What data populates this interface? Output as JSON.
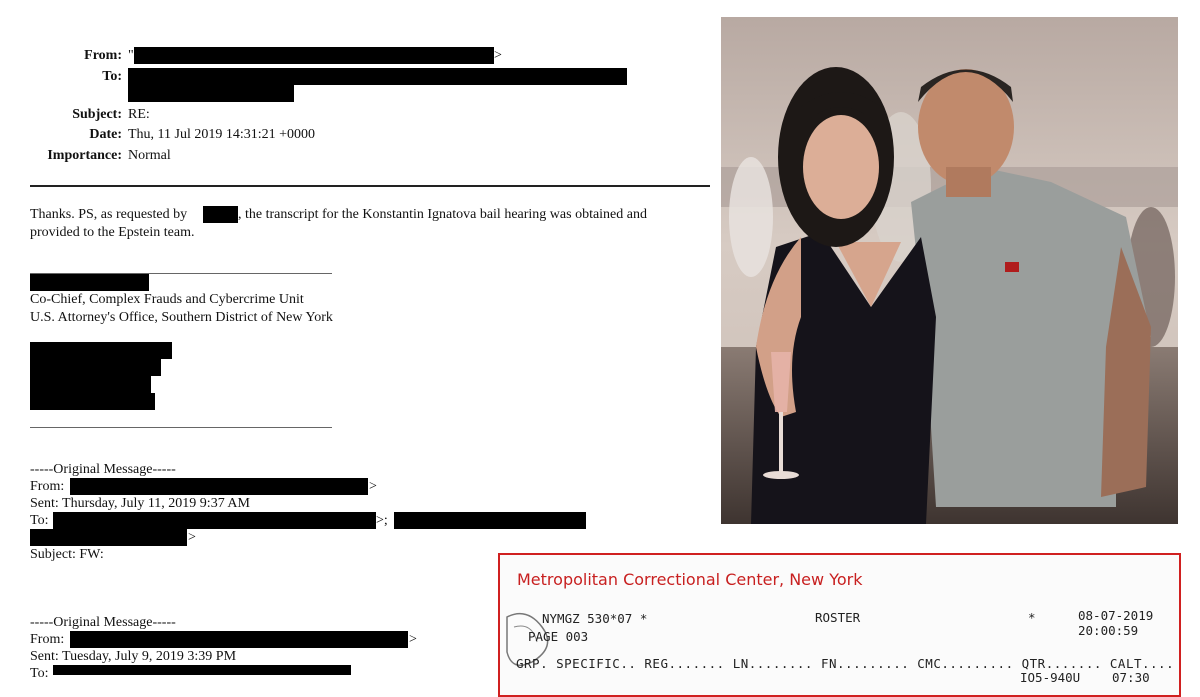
{
  "email": {
    "header": {
      "from_label": "From:",
      "from_prefix": "\"",
      "from_suffix": ">",
      "to_label": "To:",
      "subject_label": "Subject:",
      "subject_value": "RE:",
      "date_label": "Date:",
      "date_value": "Thu, 11 Jul 2019 14:31:21 +0000",
      "importance_label": "Importance:",
      "importance_value": "Normal"
    },
    "body_line1_a": "Thanks. PS, as requested by",
    "body_line1_b": ", the transcript for the Konstantin Ignatova bail hearing was obtained and",
    "body_line2": "provided to the Epstein team.",
    "signature_title": "Co-Chief, Complex Frauds and Cybercrime Unit",
    "signature_office": "U.S. Attorney's Office, Southern District of New York",
    "original_1": {
      "heading": "-----Original Message-----",
      "from_label": "From:",
      "from_suffix": ">",
      "sent_line": "Sent: Thursday, July 11, 2019 9:37 AM",
      "to_label": "To:",
      "to_sep": ">;",
      "to_suffix": ">",
      "subject_line": "Subject: FW:"
    },
    "original_2": {
      "heading": "-----Original Message-----",
      "from_label": "From:",
      "from_suffix": ">",
      "sent_line": "Sent: Tuesday, July 9, 2019 3:39 PM",
      "to_label": "To:"
    }
  },
  "roster": {
    "title": "Metropolitan Correctional Center, New York",
    "line1_a": "NYMGZ  530*07 *",
    "line1_b": "ROSTER",
    "line1_c": "*",
    "line1_d": "08-07-2019",
    "line2_a": "PAGE 003",
    "line2_d": "20:00:59",
    "line3": "GRP. SPECIFIC.. REG....... LN........ FN......... CMC......... QTR....... CALT....",
    "line4_a": "IO5-940U",
    "line4_b": "07:30"
  },
  "colors": {
    "accent_red": "#c82020",
    "redaction": "#000000"
  }
}
